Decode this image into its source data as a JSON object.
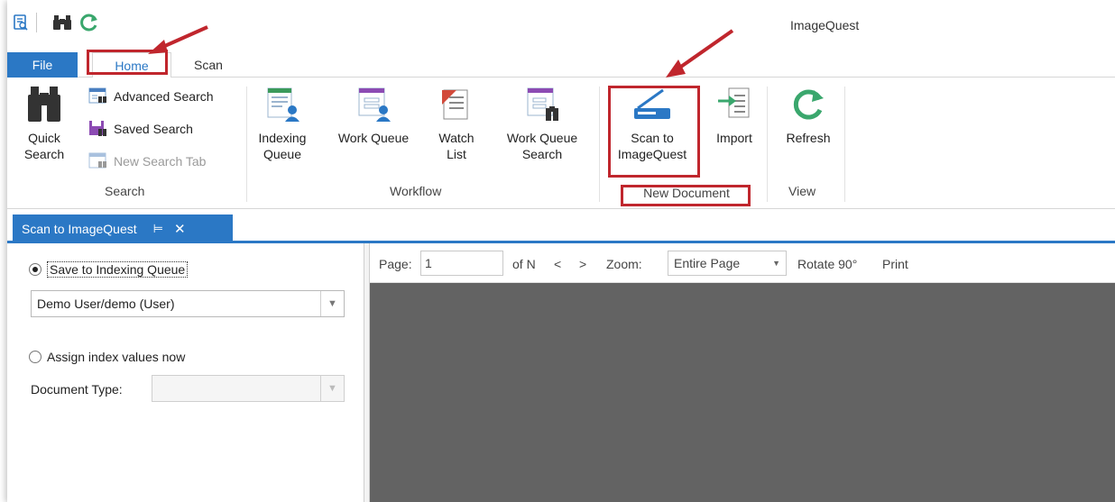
{
  "app": {
    "title": "ImageQuest"
  },
  "quick_access": {
    "icons": [
      "app-icon",
      "binoculars-icon",
      "refresh-icon"
    ]
  },
  "tabs": {
    "file": "File",
    "home": "Home",
    "scan": "Scan"
  },
  "ribbon": {
    "search_group": {
      "label": "Search",
      "quick_search": "Quick\nSearch",
      "advanced_search": "Advanced Search",
      "saved_search": "Saved Search",
      "new_search_tab": "New Search Tab"
    },
    "workflow_group": {
      "label": "Workflow",
      "indexing_queue": "Indexing\nQueue",
      "work_queue": "Work Queue",
      "watch_list": "Watch\nList",
      "work_queue_search": "Work Queue\nSearch"
    },
    "new_document_group": {
      "label": "New Document",
      "scan_to_imagequest": "Scan to\nImageQuest",
      "import": "Import"
    },
    "view_group": {
      "label": "View",
      "refresh": "Refresh"
    }
  },
  "doc_tab": {
    "label": "Scan to ImageQuest",
    "pin": "⊨",
    "close": "✕"
  },
  "left_panel": {
    "save_option": "Save to Indexing Queue",
    "queue_select": "Demo User/demo (User)",
    "assign_option": "Assign index values now",
    "document_type_label": "Document Type:",
    "document_type_value": ""
  },
  "viewer": {
    "page_label": "Page:",
    "page_value": "1",
    "of_n": "of N",
    "prev": "<",
    "next": ">",
    "zoom_label": "Zoom:",
    "zoom_value": "Entire Page",
    "rotate": "Rotate 90°",
    "print": "Print"
  },
  "colors": {
    "accent": "#2b78c5",
    "highlight": "#c0262d",
    "canvas": "#636363"
  }
}
